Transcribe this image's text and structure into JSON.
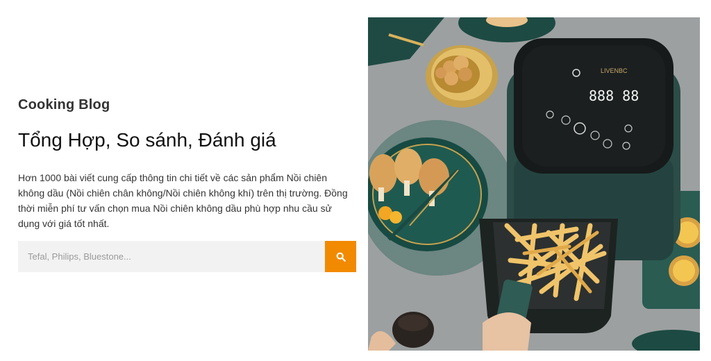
{
  "hero": {
    "eyebrow": "Cooking Blog",
    "title": "Tổng Hợp, So sánh, Đánh giá",
    "description": "Hơn 1000 bài viết cung cấp thông tin chi tiết về các sản phẩm Nồi chiên không dầu (Nồi chiên chân không/Nồi chiên không khí) trên thị trường. Đồng thời miễn phí tư vấn chọn mua Nồi chiên không dầu phù hợp nhu cầu sử dụng với giá tốt nhất."
  },
  "search": {
    "placeholder": "Tefal, Philips, Bluestone...",
    "value": "",
    "icon": "search-icon",
    "button_color": "#f28a00"
  },
  "image": {
    "display_digits": "888 88",
    "brand": "LIVENBC"
  }
}
